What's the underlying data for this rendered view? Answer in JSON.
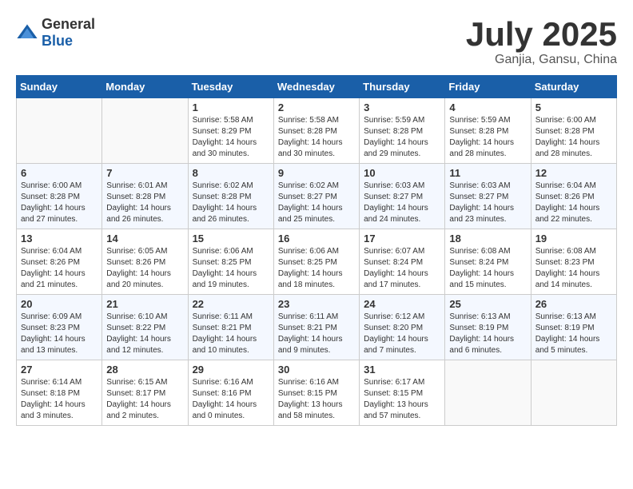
{
  "header": {
    "logo_general": "General",
    "logo_blue": "Blue",
    "month": "July 2025",
    "location": "Ganjia, Gansu, China"
  },
  "weekdays": [
    "Sunday",
    "Monday",
    "Tuesday",
    "Wednesday",
    "Thursday",
    "Friday",
    "Saturday"
  ],
  "weeks": [
    [
      {
        "day": "",
        "info": ""
      },
      {
        "day": "",
        "info": ""
      },
      {
        "day": "1",
        "info": "Sunrise: 5:58 AM\nSunset: 8:29 PM\nDaylight: 14 hours and 30 minutes."
      },
      {
        "day": "2",
        "info": "Sunrise: 5:58 AM\nSunset: 8:28 PM\nDaylight: 14 hours and 30 minutes."
      },
      {
        "day": "3",
        "info": "Sunrise: 5:59 AM\nSunset: 8:28 PM\nDaylight: 14 hours and 29 minutes."
      },
      {
        "day": "4",
        "info": "Sunrise: 5:59 AM\nSunset: 8:28 PM\nDaylight: 14 hours and 28 minutes."
      },
      {
        "day": "5",
        "info": "Sunrise: 6:00 AM\nSunset: 8:28 PM\nDaylight: 14 hours and 28 minutes."
      }
    ],
    [
      {
        "day": "6",
        "info": "Sunrise: 6:00 AM\nSunset: 8:28 PM\nDaylight: 14 hours and 27 minutes."
      },
      {
        "day": "7",
        "info": "Sunrise: 6:01 AM\nSunset: 8:28 PM\nDaylight: 14 hours and 26 minutes."
      },
      {
        "day": "8",
        "info": "Sunrise: 6:02 AM\nSunset: 8:28 PM\nDaylight: 14 hours and 26 minutes."
      },
      {
        "day": "9",
        "info": "Sunrise: 6:02 AM\nSunset: 8:27 PM\nDaylight: 14 hours and 25 minutes."
      },
      {
        "day": "10",
        "info": "Sunrise: 6:03 AM\nSunset: 8:27 PM\nDaylight: 14 hours and 24 minutes."
      },
      {
        "day": "11",
        "info": "Sunrise: 6:03 AM\nSunset: 8:27 PM\nDaylight: 14 hours and 23 minutes."
      },
      {
        "day": "12",
        "info": "Sunrise: 6:04 AM\nSunset: 8:26 PM\nDaylight: 14 hours and 22 minutes."
      }
    ],
    [
      {
        "day": "13",
        "info": "Sunrise: 6:04 AM\nSunset: 8:26 PM\nDaylight: 14 hours and 21 minutes."
      },
      {
        "day": "14",
        "info": "Sunrise: 6:05 AM\nSunset: 8:26 PM\nDaylight: 14 hours and 20 minutes."
      },
      {
        "day": "15",
        "info": "Sunrise: 6:06 AM\nSunset: 8:25 PM\nDaylight: 14 hours and 19 minutes."
      },
      {
        "day": "16",
        "info": "Sunrise: 6:06 AM\nSunset: 8:25 PM\nDaylight: 14 hours and 18 minutes."
      },
      {
        "day": "17",
        "info": "Sunrise: 6:07 AM\nSunset: 8:24 PM\nDaylight: 14 hours and 17 minutes."
      },
      {
        "day": "18",
        "info": "Sunrise: 6:08 AM\nSunset: 8:24 PM\nDaylight: 14 hours and 15 minutes."
      },
      {
        "day": "19",
        "info": "Sunrise: 6:08 AM\nSunset: 8:23 PM\nDaylight: 14 hours and 14 minutes."
      }
    ],
    [
      {
        "day": "20",
        "info": "Sunrise: 6:09 AM\nSunset: 8:23 PM\nDaylight: 14 hours and 13 minutes."
      },
      {
        "day": "21",
        "info": "Sunrise: 6:10 AM\nSunset: 8:22 PM\nDaylight: 14 hours and 12 minutes."
      },
      {
        "day": "22",
        "info": "Sunrise: 6:11 AM\nSunset: 8:21 PM\nDaylight: 14 hours and 10 minutes."
      },
      {
        "day": "23",
        "info": "Sunrise: 6:11 AM\nSunset: 8:21 PM\nDaylight: 14 hours and 9 minutes."
      },
      {
        "day": "24",
        "info": "Sunrise: 6:12 AM\nSunset: 8:20 PM\nDaylight: 14 hours and 7 minutes."
      },
      {
        "day": "25",
        "info": "Sunrise: 6:13 AM\nSunset: 8:19 PM\nDaylight: 14 hours and 6 minutes."
      },
      {
        "day": "26",
        "info": "Sunrise: 6:13 AM\nSunset: 8:19 PM\nDaylight: 14 hours and 5 minutes."
      }
    ],
    [
      {
        "day": "27",
        "info": "Sunrise: 6:14 AM\nSunset: 8:18 PM\nDaylight: 14 hours and 3 minutes."
      },
      {
        "day": "28",
        "info": "Sunrise: 6:15 AM\nSunset: 8:17 PM\nDaylight: 14 hours and 2 minutes."
      },
      {
        "day": "29",
        "info": "Sunrise: 6:16 AM\nSunset: 8:16 PM\nDaylight: 14 hours and 0 minutes."
      },
      {
        "day": "30",
        "info": "Sunrise: 6:16 AM\nSunset: 8:15 PM\nDaylight: 13 hours and 58 minutes."
      },
      {
        "day": "31",
        "info": "Sunrise: 6:17 AM\nSunset: 8:15 PM\nDaylight: 13 hours and 57 minutes."
      },
      {
        "day": "",
        "info": ""
      },
      {
        "day": "",
        "info": ""
      }
    ]
  ]
}
